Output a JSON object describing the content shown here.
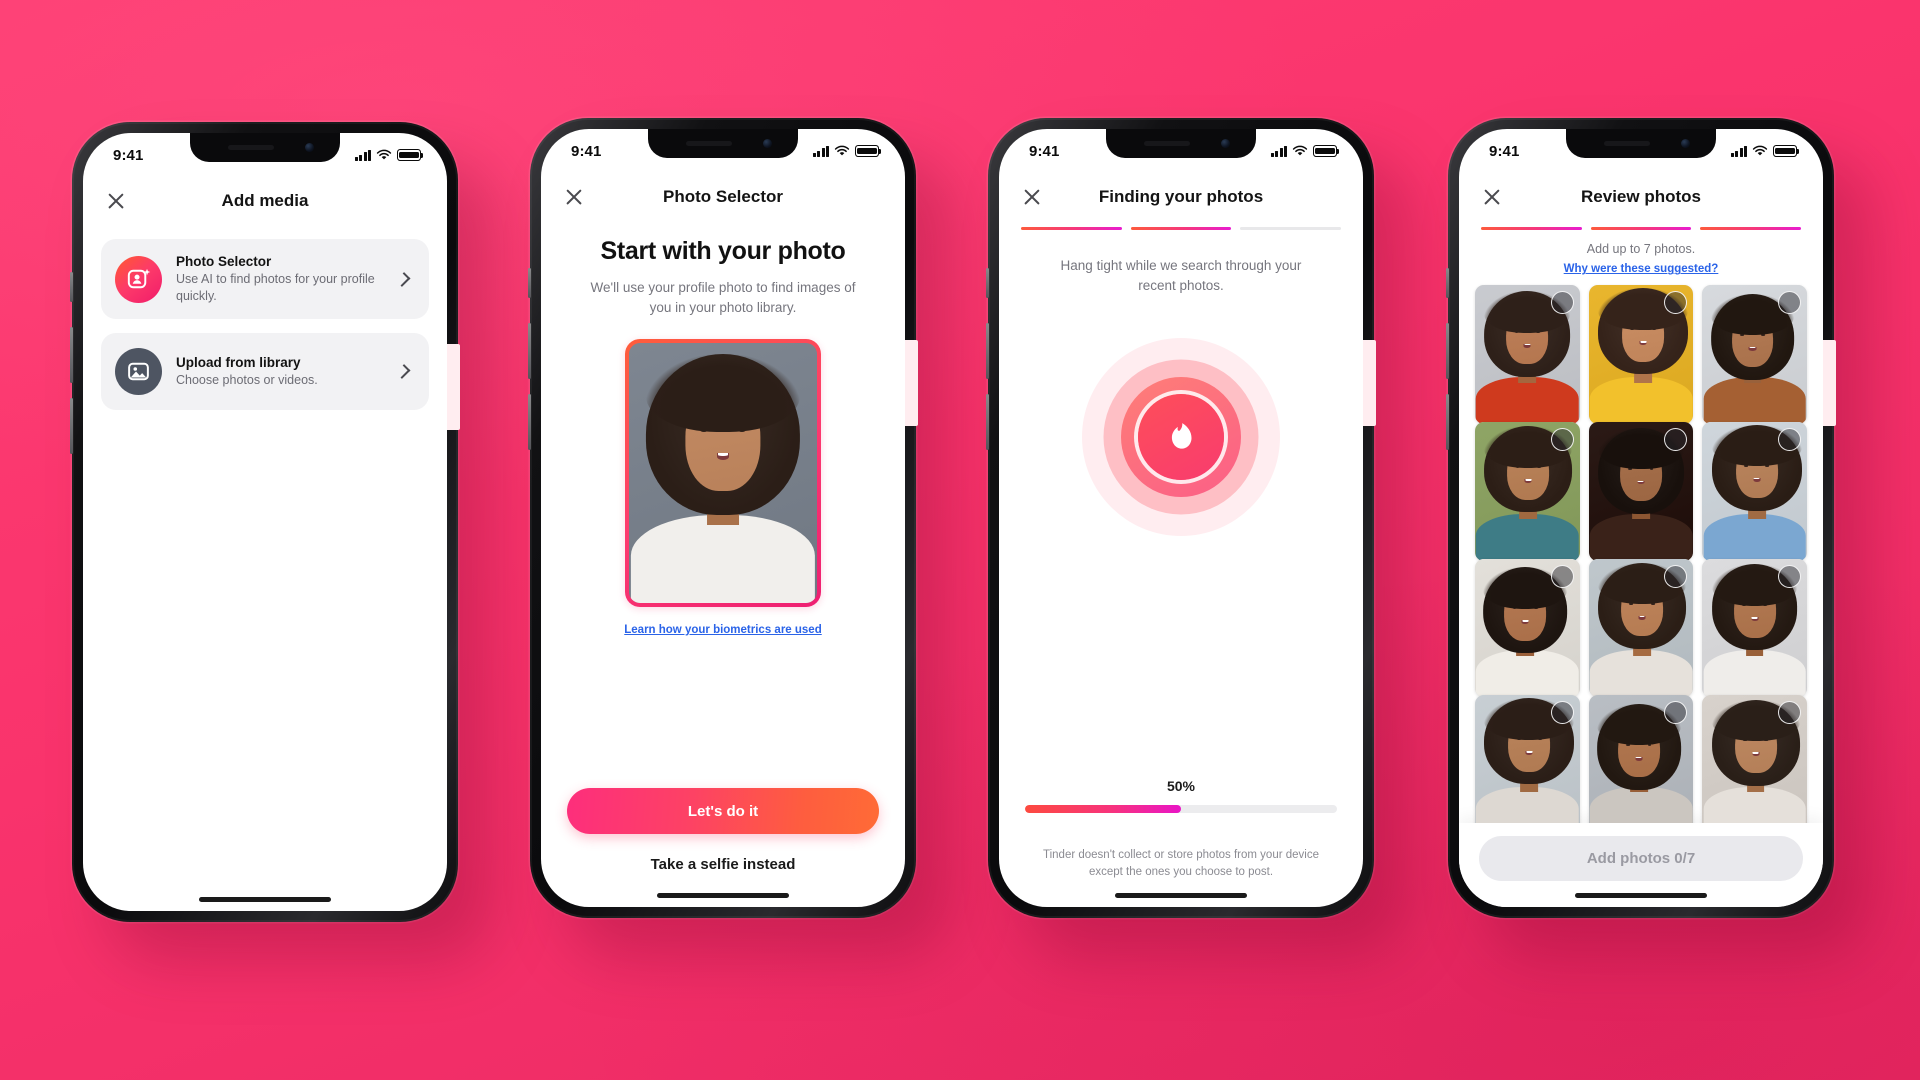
{
  "theme": {
    "background": "#FB3A70",
    "brand_gradient_start": "#FE5A2E",
    "brand_gradient_end": "#F01C6A",
    "link_blue": "#2A63E8"
  },
  "status_bar": {
    "time": "9:41",
    "icons": [
      "cellular-signal-icon",
      "wifi-icon",
      "battery-icon"
    ]
  },
  "screens": [
    {
      "id": "add-media",
      "nav": {
        "close_icon": "close-icon",
        "title": "Add media"
      },
      "options": [
        {
          "icon": "photo-selector-ai-icon",
          "title": "Photo Selector",
          "subtitle": "Use AI to find photos for your profile quickly.",
          "chevron": "chevron-right-icon"
        },
        {
          "icon": "image-library-icon",
          "title": "Upload from library",
          "subtitle": "Choose photos or videos.",
          "chevron": "chevron-right-icon"
        }
      ]
    },
    {
      "id": "photo-selector",
      "nav": {
        "close_icon": "close-icon",
        "title": "Photo Selector"
      },
      "heading": "Start with your photo",
      "subtitle": "We'll use your profile photo to find images of you in your photo library.",
      "biometrics_link": "Learn how your biometrics are used",
      "primary_button": "Let's do it",
      "secondary_button": "Take a selfie instead"
    },
    {
      "id": "finding-your-photos",
      "nav": {
        "close_icon": "close-icon",
        "title": "Finding your photos"
      },
      "steps": {
        "total": 3,
        "completed": 2
      },
      "message": "Hang tight while we search through your recent photos.",
      "loader_icon": "tinder-flame-icon",
      "progress_label": "50%",
      "progress_value": 50,
      "disclaimer": "Tinder doesn't collect or store photos from your device except the ones you choose to post."
    },
    {
      "id": "review-photos",
      "nav": {
        "close_icon": "close-icon",
        "title": "Review photos"
      },
      "steps": {
        "total": 3,
        "completed": 3
      },
      "caption": "Add up to 7 photos.",
      "why_link": "Why were these suggested?",
      "add_button": "Add photos 0/7",
      "selected_count": 0,
      "max_photos": 7,
      "photos": [
        {
          "alt": "woman-laughing-red-shirt",
          "bg": "#C9CBD0",
          "skin": "#B4764F",
          "hair": "#2E2019",
          "top": "#CF3A1E"
        },
        {
          "alt": "woman-smiling-yellow-hoodie",
          "bg": "#E9B62E",
          "skin": "#C0845A",
          "hair": "#35231A",
          "top": "#F2C12C"
        },
        {
          "alt": "woman-tan-coat-white-scarf",
          "bg": "#D7DADE",
          "skin": "#A9714B",
          "hair": "#211710",
          "top": "#A56033"
        },
        {
          "alt": "woman-with-plants-outdoors",
          "bg": "#8FA566",
          "skin": "#B07950",
          "hair": "#2C1E16",
          "top": "#3E7C86"
        },
        {
          "alt": "woman-dark-portrait-closeup",
          "bg": "#2B1A16",
          "skin": "#9C6642",
          "hair": "#18100C",
          "top": "#3A2219"
        },
        {
          "alt": "woman-blue-tank-top",
          "bg": "#CFD6DC",
          "skin": "#B07B54",
          "hair": "#2A1D15",
          "top": "#7BA7D1"
        },
        {
          "alt": "woman-hands-near-face",
          "bg": "#E3E0DA",
          "skin": "#AA6F49",
          "hair": "#1E1510",
          "top": "#F0EDE7"
        },
        {
          "alt": "woman-pursed-lips-outdoors",
          "bg": "#BFC7CC",
          "skin": "#B57B52",
          "hair": "#2B1E16",
          "top": "#E6E1DB"
        },
        {
          "alt": "woman-hand-on-chin-smiling",
          "bg": "#DCDCDE",
          "skin": "#A97049",
          "hair": "#241912",
          "top": "#EFEDEA"
        },
        {
          "alt": "woman-looking-up-smiling",
          "bg": "#C8CFD4",
          "skin": "#B07A52",
          "hair": "#2B1E17",
          "top": "#DDD8D2"
        },
        {
          "alt": "woman-neutral-expression",
          "bg": "#B9BEC4",
          "skin": "#A86E47",
          "hair": "#221811",
          "top": "#CBC6C0"
        },
        {
          "alt": "woman-face-closeup-soft",
          "bg": "#D8D2CC",
          "skin": "#B47F58",
          "hair": "#2A1F18",
          "top": "#E5E0DA"
        }
      ]
    }
  ],
  "profile_photo": {
    "alt": "woman-laughing-hand-on-chin-grey-background",
    "bg": "#7E8691",
    "skin": "#B9815A",
    "hair": "#2B1E17",
    "top": "#F1EFEC"
  }
}
